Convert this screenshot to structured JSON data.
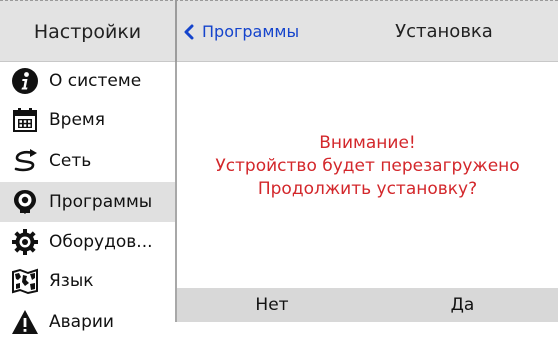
{
  "header": {
    "left_title": "Настройки",
    "back_label": "Программы",
    "title": "Установка"
  },
  "sidebar": {
    "items": [
      {
        "label": "О системе",
        "icon": "info-icon"
      },
      {
        "label": "Время",
        "icon": "calendar-icon"
      },
      {
        "label": "Сеть",
        "icon": "network-icon"
      },
      {
        "label": "Программы",
        "icon": "programs-icon",
        "active": true
      },
      {
        "label": "Оборудов...",
        "icon": "gear-icon"
      },
      {
        "label": "Язык",
        "icon": "map-icon"
      },
      {
        "label": "Аварии",
        "icon": "warning-icon"
      }
    ]
  },
  "dialog": {
    "line1": "Внимание!",
    "line2": "Устройство будет перезагружено",
    "line3": "Продолжить установку?"
  },
  "buttons": {
    "no": "Нет",
    "yes": "Да"
  },
  "colors": {
    "link": "#1544cc",
    "warning_text": "#d3272b",
    "header_bg": "#e3e3e3",
    "active_item_bg": "#e0e0e0",
    "button_bar_bg": "#d8d8d8"
  }
}
